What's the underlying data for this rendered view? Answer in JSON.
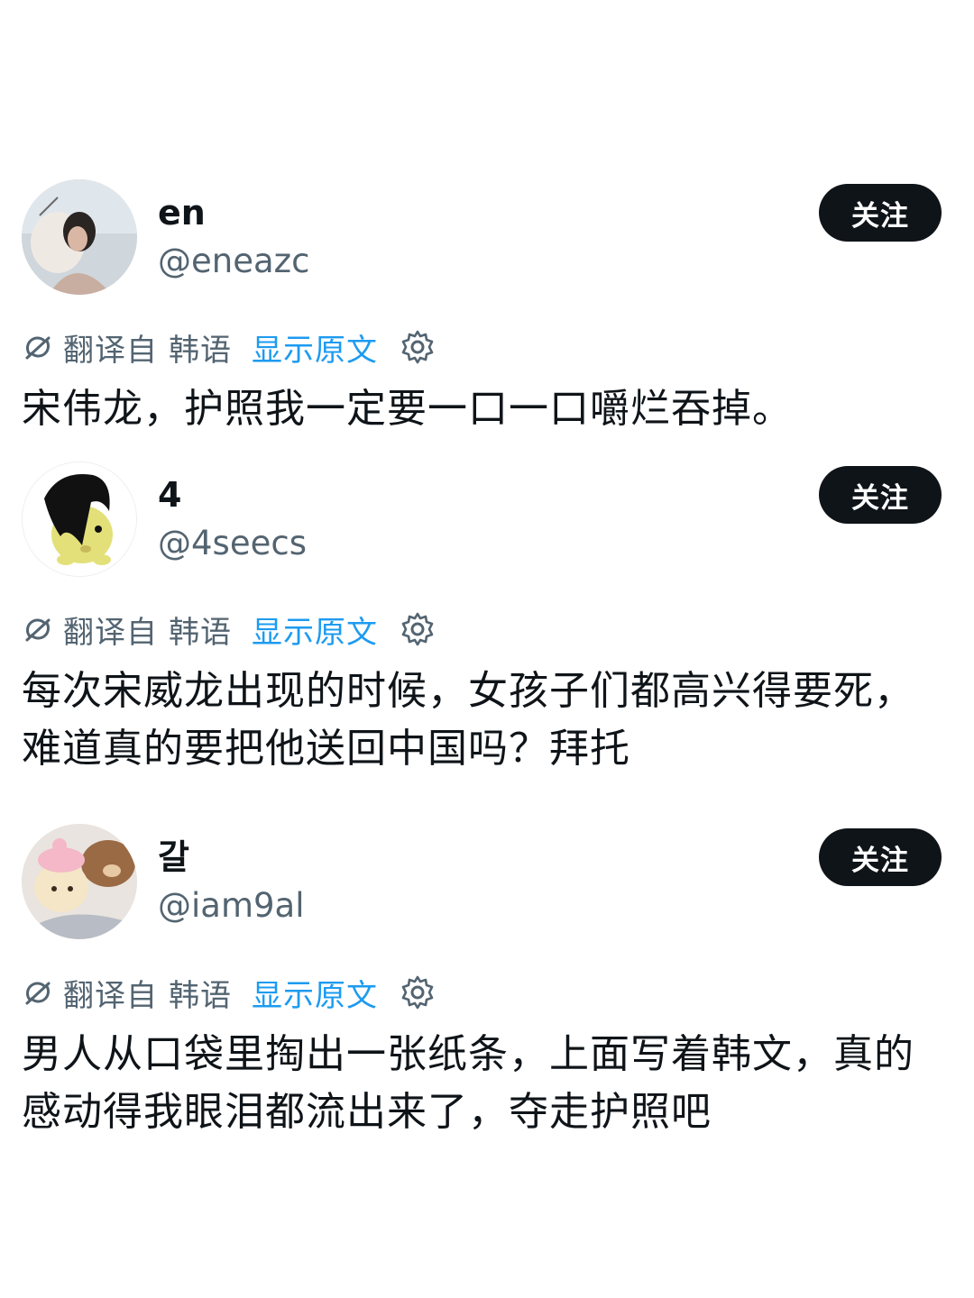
{
  "posts": [
    {
      "display_name": "en",
      "handle": "@eneazc",
      "follow_label": "关注",
      "translated_from_label": "翻译自",
      "source_language": "韩语",
      "show_original_label": "显示原文",
      "text": "宋伟龙，护照我一定要一口一口嚼烂吞掉。"
    },
    {
      "display_name": "4",
      "handle": "@4seecs",
      "follow_label": "关注",
      "translated_from_label": "翻译自",
      "source_language": "韩语",
      "show_original_label": "显示原文",
      "text": "每次宋威龙出现的时候，女孩子们都高兴得要死，难道真的要把他送回中国吗？拜托"
    },
    {
      "display_name": "갈",
      "handle": "@iam9al",
      "follow_label": "关注",
      "translated_from_label": "翻译自",
      "source_language": "韩语",
      "show_original_label": "显示原文",
      "text": "男人从口袋里掏出一张纸条，上面写着韩文，真的感动得我眼泪都流出来了，夺走护照吧"
    }
  ],
  "colors": {
    "text_primary": "#0f1419",
    "text_secondary": "#536471",
    "link": "#1d9bf0",
    "button_bg": "#0f1419",
    "button_text": "#ffffff"
  },
  "icons": {
    "translate": "translate-icon",
    "settings": "gear-icon"
  }
}
